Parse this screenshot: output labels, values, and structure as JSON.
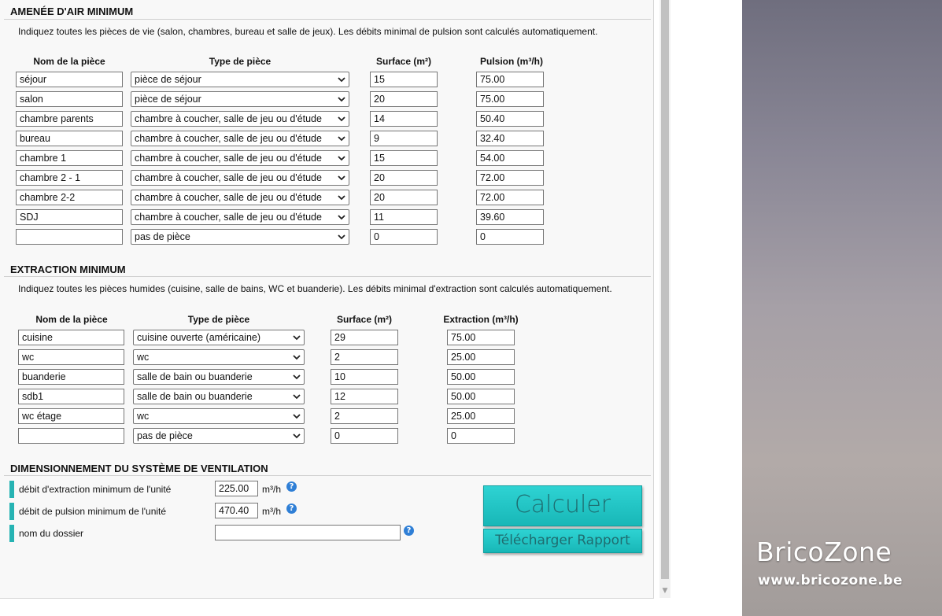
{
  "supply": {
    "title": "AMENÉE D'AIR MINIMUM",
    "description": "Indiquez toutes les pièces de vie (salon, chambres, bureau et salle de jeux). Les débits minimal de pulsion sont calculés automatiquement.",
    "headers": {
      "name": "Nom de la pièce",
      "type": "Type de pièce",
      "surface": "Surface (m²)",
      "flow": "Pulsion (m³/h)"
    },
    "rows": [
      {
        "name": "séjour",
        "type": "pièce de séjour",
        "surface": "15",
        "flow": "75.00"
      },
      {
        "name": "salon",
        "type": "pièce de séjour",
        "surface": "20",
        "flow": "75.00"
      },
      {
        "name": "chambre parents",
        "type": "chambre à coucher, salle de jeu ou d'étude",
        "surface": "14",
        "flow": "50.40"
      },
      {
        "name": "bureau",
        "type": "chambre à coucher, salle de jeu ou d'étude",
        "surface": "9",
        "flow": "32.40"
      },
      {
        "name": "chambre 1",
        "type": "chambre à coucher, salle de jeu ou d'étude",
        "surface": "15",
        "flow": "54.00"
      },
      {
        "name": "chambre 2 - 1",
        "type": "chambre à coucher, salle de jeu ou d'étude",
        "surface": "20",
        "flow": "72.00"
      },
      {
        "name": "chambre 2-2",
        "type": "chambre à coucher, salle de jeu ou d'étude",
        "surface": "20",
        "flow": "72.00"
      },
      {
        "name": "SDJ",
        "type": "chambre à coucher, salle de jeu ou d'étude",
        "surface": "11",
        "flow": "39.60"
      },
      {
        "name": "",
        "type": "pas de pièce",
        "surface": "0",
        "flow": "0"
      }
    ]
  },
  "extraction": {
    "title": "EXTRACTION MINIMUM",
    "description": "Indiquez toutes les pièces humides (cuisine, salle de bains, WC et buanderie). Les débits minimal d'extraction sont calculés automatiquement.",
    "headers": {
      "name": "Nom de la pièce",
      "type": "Type de pièce",
      "surface": "Surface (m²)",
      "flow": "Extraction (m³/h)"
    },
    "rows": [
      {
        "name": "cuisine",
        "type": "cuisine ouverte (américaine)",
        "surface": "29",
        "flow": "75.00"
      },
      {
        "name": "wc",
        "type": "wc",
        "surface": "2",
        "flow": "25.00"
      },
      {
        "name": "buanderie",
        "type": "salle de bain ou buanderie",
        "surface": "10",
        "flow": "50.00"
      },
      {
        "name": "sdb1",
        "type": "salle de bain ou buanderie",
        "surface": "12",
        "flow": "50.00"
      },
      {
        "name": "wc étage",
        "type": "wc",
        "surface": "2",
        "flow": "25.00"
      },
      {
        "name": "",
        "type": "pas de pièce",
        "surface": "0",
        "flow": "0"
      }
    ]
  },
  "sizing": {
    "title": "DIMENSIONNEMENT DU SYSTÈME DE VENTILATION",
    "extraction_label": "débit d'extraction minimum de l'unité",
    "extraction_value": "225.00",
    "supply_label": "débit de pulsion minimum de l'unité",
    "supply_value": "470.40",
    "unit": "m³/h",
    "folder_label": "nom du dossier",
    "folder_value": "",
    "help_glyph": "?",
    "calculate_label": "Calculer",
    "report_label": "Télécharger Rapport"
  },
  "brand": {
    "name": "BricoZone",
    "url": "www.bricozone.be"
  },
  "colors": {
    "accent": "#26b3b3",
    "button": "#1fc4c4",
    "help": "#2f7fd6"
  }
}
